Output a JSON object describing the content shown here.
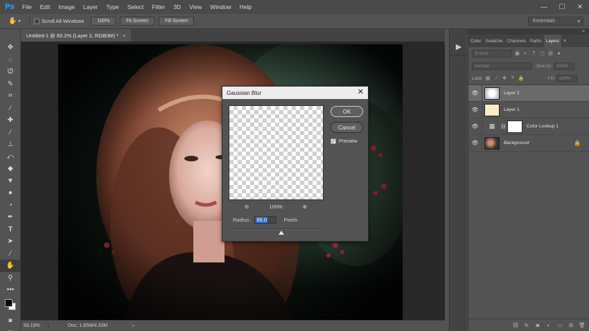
{
  "app": {
    "logo": "Ps"
  },
  "menu": [
    "File",
    "Edit",
    "Image",
    "Layer",
    "Type",
    "Select",
    "Filter",
    "3D",
    "View",
    "Window",
    "Help"
  ],
  "window_controls": [
    "—",
    "☐",
    "✕"
  ],
  "options": {
    "scroll_all_windows": "Scroll All Windows",
    "zoom_btn": "100%",
    "fit_screen": "Fit Screen",
    "fill_screen": "Fill Screen",
    "workspace": "Essentials"
  },
  "document": {
    "tab_title": "Untitled-1 @ 83.2% (Layer 2, RGB/8#) *",
    "tab_close": "×"
  },
  "status": {
    "zoom": "83.19%",
    "doc": "Doc: 1.85M/4.33M",
    "arrow": ">"
  },
  "panel_tabs": [
    "Color",
    "Swatche",
    "Channels",
    "Paths",
    "Layers"
  ],
  "layers_panel": {
    "filter_kind": "Kind",
    "blend_mode": "Normal",
    "opacity_label": "Opacity:",
    "opacity_value": "100%",
    "lock_label": "Lock:",
    "fill_label": "Fill:",
    "fill_value": "100%",
    "layers": [
      {
        "name": "Layer 2"
      },
      {
        "name": "Layer 1"
      },
      {
        "name": "Color Lookup 1"
      },
      {
        "name": "Background"
      }
    ]
  },
  "dialog": {
    "title": "Gaussian Blur",
    "ok": "OK",
    "cancel": "Cancel",
    "preview_label": "Preview",
    "preview_checked": true,
    "zoom_level": "100%",
    "radius_label": "Radius:",
    "radius_value": "65.0",
    "radius_unit": "Pixels"
  }
}
